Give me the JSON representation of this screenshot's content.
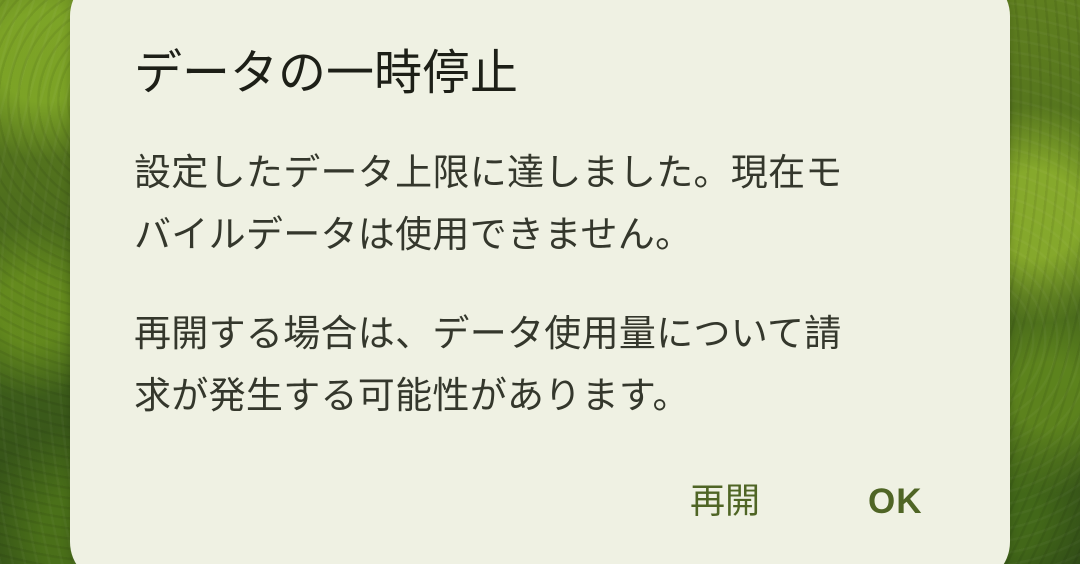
{
  "dialog": {
    "title": "データの一時停止",
    "message_1": [
      "設定したデータ上限に達しました。現在モ",
      "バイルデータは使用できません。"
    ],
    "message_2": [
      "再開する場合は、データ使用量について請",
      "求が発生する可能性があります。"
    ],
    "actions": {
      "resume": "再開",
      "ok": "OK"
    }
  },
  "colors": {
    "dialog_background": "#eff1e3",
    "title_text": "#1d1f17",
    "body_text": "#34372c",
    "action_text": "#4f6525"
  }
}
